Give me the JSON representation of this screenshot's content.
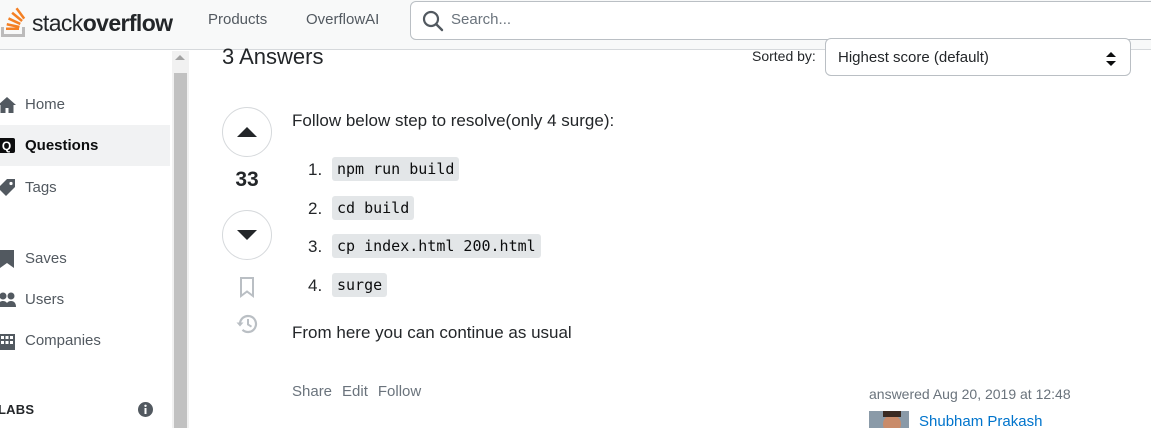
{
  "header": {
    "logo_light": "stack",
    "logo_bold": "overflow",
    "nav": [
      "Products",
      "OverflowAI"
    ],
    "search_placeholder": "Search..."
  },
  "sidebar": {
    "items": [
      {
        "label": "Home",
        "icon": "home-icon"
      },
      {
        "label": "Questions",
        "icon": "questions-icon",
        "active": true
      },
      {
        "label": "Tags",
        "icon": "tag-icon"
      },
      {
        "label": "Saves",
        "icon": "bookmark-icon"
      },
      {
        "label": "Users",
        "icon": "users-icon"
      },
      {
        "label": "Companies",
        "icon": "companies-icon"
      }
    ],
    "labs_label": "LABS"
  },
  "answers_header": {
    "title": "3 Answers",
    "sorted_label": "Sorted by:",
    "sort_value": "Highest score (default)"
  },
  "answer": {
    "score": "33",
    "intro": "Follow below step to resolve(only 4 surge):",
    "steps": [
      {
        "num": "1.",
        "code": "npm run build"
      },
      {
        "num": "2.",
        "code": "cd build"
      },
      {
        "num": "3.",
        "code": "cp index.html 200.html"
      },
      {
        "num": "4.",
        "code": "surge"
      }
    ],
    "outro": "From here you can continue as usual",
    "actions": [
      "Share",
      "Edit",
      "Follow"
    ],
    "answered": "answered Aug 20, 2019 at 12:48",
    "user": "Shubham Prakash"
  },
  "colors": {
    "accent": "#f48024",
    "link": "#0074cc",
    "text": "#232629",
    "muted": "#6a737c"
  }
}
